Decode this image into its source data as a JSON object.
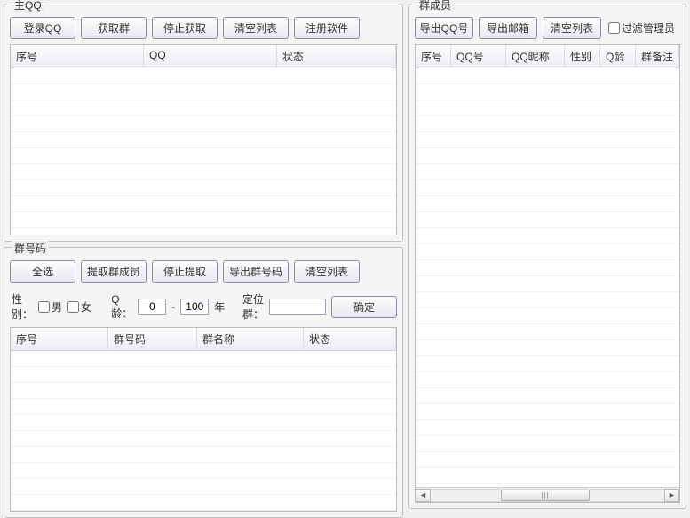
{
  "panels": {
    "mainqq": {
      "title": "主QQ",
      "buttons": {
        "login": "登录QQ",
        "getgroups": "获取群",
        "stopget": "停止获取",
        "clear": "清空列表",
        "register": "注册软件"
      },
      "columns": {
        "seq": "序号",
        "qq": "QQ",
        "status": "状态"
      }
    },
    "groupids": {
      "title": "群号码",
      "buttons": {
        "selectall": "全选",
        "extract": "提取群成员",
        "stopextract": "停止提取",
        "exportids": "导出群号码",
        "clear": "清空列表"
      },
      "filter": {
        "gender_label": "性别：",
        "male": "男",
        "female": "女",
        "qage_label": "Q龄：",
        "qage_from": "0",
        "dash": "-",
        "qage_to": "100",
        "year": "年",
        "locate_label": "定位群：",
        "locate_value": "",
        "ok": "确定"
      },
      "columns": {
        "seq": "序号",
        "groupid": "群号码",
        "groupname": "群名称",
        "status": "状态"
      }
    },
    "members": {
      "title": "群成员",
      "buttons": {
        "exportqq": "导出QQ号",
        "exportmail": "导出邮箱",
        "clear": "清空列表"
      },
      "filter_admin": "过滤管理员",
      "columns": {
        "seq": "序号",
        "qqno": "QQ号",
        "nick": "QQ昵称",
        "gender": "性别",
        "qage": "Q龄",
        "remark": "群备注"
      }
    }
  }
}
